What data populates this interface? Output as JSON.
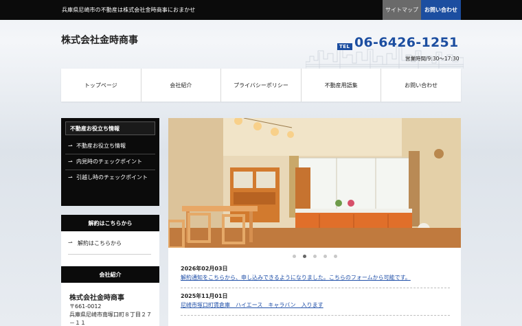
{
  "topbar": {
    "tagline": "兵庫県尼崎市の不動産は株式会社金時商事におまかせ",
    "sitemap_label": "サイトマップ",
    "contact_label": "お問い合わせ"
  },
  "header": {
    "company_name": "株式会社金時商事",
    "tel_label": "TEL",
    "tel_number": "06-6426-1251",
    "hours": "営業時間/9:30〜17:30"
  },
  "nav": {
    "items": [
      {
        "label": "トップページ"
      },
      {
        "label": "会社紹介"
      },
      {
        "label": "プライバシーポリシー"
      },
      {
        "label": "不動産用語集"
      },
      {
        "label": "お問い合わせ"
      }
    ]
  },
  "sidebar": {
    "info_title": "不動産お役立ち情報",
    "info_items": [
      {
        "label": "不動産お役立ち情報"
      },
      {
        "label": "内見時のチェックポイント"
      },
      {
        "label": "引越し時のチェックポイント"
      }
    ],
    "cancel_title": "解約はこちらから",
    "cancel_items": [
      {
        "label": "解約はこちらから"
      }
    ],
    "company_title": "会社紹介",
    "company_name": "株式会社金時商事",
    "zip": "〒661-0012",
    "address": "兵庫県尼崎市南塚口町８丁目２７－１１"
  },
  "slider": {
    "total": 5,
    "active": 2
  },
  "news": [
    {
      "date": "2026年02月03日",
      "text": "解約通知をこちらから、申し込みできるようになりました。こちらのフォームから可能です。"
    },
    {
      "date": "2025年11月01日",
      "text": "尼崎市塚口町賃倉庫　ハイエース　キャラバン　入ります"
    }
  ],
  "colors": {
    "brand_blue": "#1c4ea0",
    "dark": "#0b0b0b",
    "link": "#1f4fa8"
  }
}
